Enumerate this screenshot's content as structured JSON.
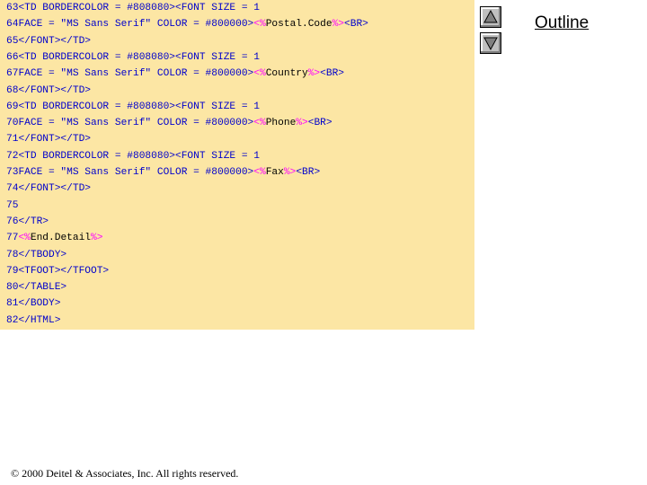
{
  "code": {
    "lines": [
      {
        "num": "63",
        "parts": [
          {
            "t": "<TD BORDERCOLOR = #808080><FONT SIZE = 1",
            "c": "code"
          }
        ]
      },
      {
        "num": "64",
        "parts": [
          {
            "t": "FACE = \"MS Sans Serif\" COLOR = #800000>",
            "c": "code"
          },
          {
            "t": "<%",
            "c": "delim"
          },
          {
            "t": "Postal.Code",
            "c": "kw"
          },
          {
            "t": "%>",
            "c": "delim"
          },
          {
            "t": "<BR>",
            "c": "code"
          }
        ]
      },
      {
        "num": "65",
        "parts": [
          {
            "t": "</FONT></TD>",
            "c": "code"
          }
        ]
      },
      {
        "num": "66",
        "parts": [
          {
            "t": "<TD BORDERCOLOR = #808080><FONT SIZE = 1",
            "c": "code"
          }
        ]
      },
      {
        "num": "67",
        "parts": [
          {
            "t": "FACE = \"MS Sans Serif\" COLOR = #800000>",
            "c": "code"
          },
          {
            "t": "<%",
            "c": "delim"
          },
          {
            "t": "Country",
            "c": "kw"
          },
          {
            "t": "%>",
            "c": "delim"
          },
          {
            "t": "<BR>",
            "c": "code"
          }
        ]
      },
      {
        "num": "68",
        "parts": [
          {
            "t": "</FONT></TD>",
            "c": "code"
          }
        ]
      },
      {
        "num": "69",
        "parts": [
          {
            "t": "<TD BORDERCOLOR = #808080><FONT SIZE = 1",
            "c": "code"
          }
        ]
      },
      {
        "num": "70",
        "parts": [
          {
            "t": "FACE = \"MS Sans Serif\" COLOR = #800000>",
            "c": "code"
          },
          {
            "t": "<%",
            "c": "delim"
          },
          {
            "t": "Phone",
            "c": "kw"
          },
          {
            "t": "%>",
            "c": "delim"
          },
          {
            "t": "<BR>",
            "c": "code"
          }
        ]
      },
      {
        "num": "71",
        "parts": [
          {
            "t": "</FONT></TD>",
            "c": "code"
          }
        ]
      },
      {
        "num": "72",
        "parts": [
          {
            "t": "<TD BORDERCOLOR = #808080><FONT SIZE = 1",
            "c": "code"
          }
        ]
      },
      {
        "num": "73",
        "parts": [
          {
            "t": "FACE = \"MS Sans Serif\" COLOR = #800000>",
            "c": "code"
          },
          {
            "t": "<%",
            "c": "delim"
          },
          {
            "t": "Fax",
            "c": "kw"
          },
          {
            "t": "%>",
            "c": "delim"
          },
          {
            "t": "<BR>",
            "c": "code"
          }
        ]
      },
      {
        "num": "74",
        "parts": [
          {
            "t": "</FONT></TD>",
            "c": "code"
          }
        ]
      },
      {
        "num": "75",
        "parts": []
      },
      {
        "num": "76",
        "parts": [
          {
            "t": "</TR>",
            "c": "code"
          }
        ]
      },
      {
        "num": "77",
        "parts": [
          {
            "t": "<%",
            "c": "delim"
          },
          {
            "t": "End.Detail",
            "c": "kw"
          },
          {
            "t": "%>",
            "c": "delim"
          }
        ]
      },
      {
        "num": "78",
        "parts": [
          {
            "t": "</TBODY>",
            "c": "code"
          }
        ]
      },
      {
        "num": "79",
        "parts": [
          {
            "t": "<TFOOT></TFOOT>",
            "c": "code"
          }
        ]
      },
      {
        "num": "80",
        "parts": [
          {
            "t": "</TABLE>",
            "c": "code"
          }
        ]
      },
      {
        "num": "81",
        "parts": [
          {
            "t": "</BODY>",
            "c": "code"
          }
        ]
      },
      {
        "num": "82",
        "parts": [
          {
            "t": "</HTML>",
            "c": "code"
          }
        ]
      }
    ]
  },
  "nav": {
    "up_icon": "triangle-up-icon",
    "down_icon": "triangle-down-icon"
  },
  "outline_label": "Outline",
  "footer": {
    "copyright_symbol": "©",
    "text": " 2000 Deitel & Associates, Inc.  All rights reserved."
  },
  "colors": {
    "panel_bg": "#fce6a4",
    "code_text": "#0000cc",
    "delimiter": "#ff00ff",
    "keyword": "#000000"
  }
}
